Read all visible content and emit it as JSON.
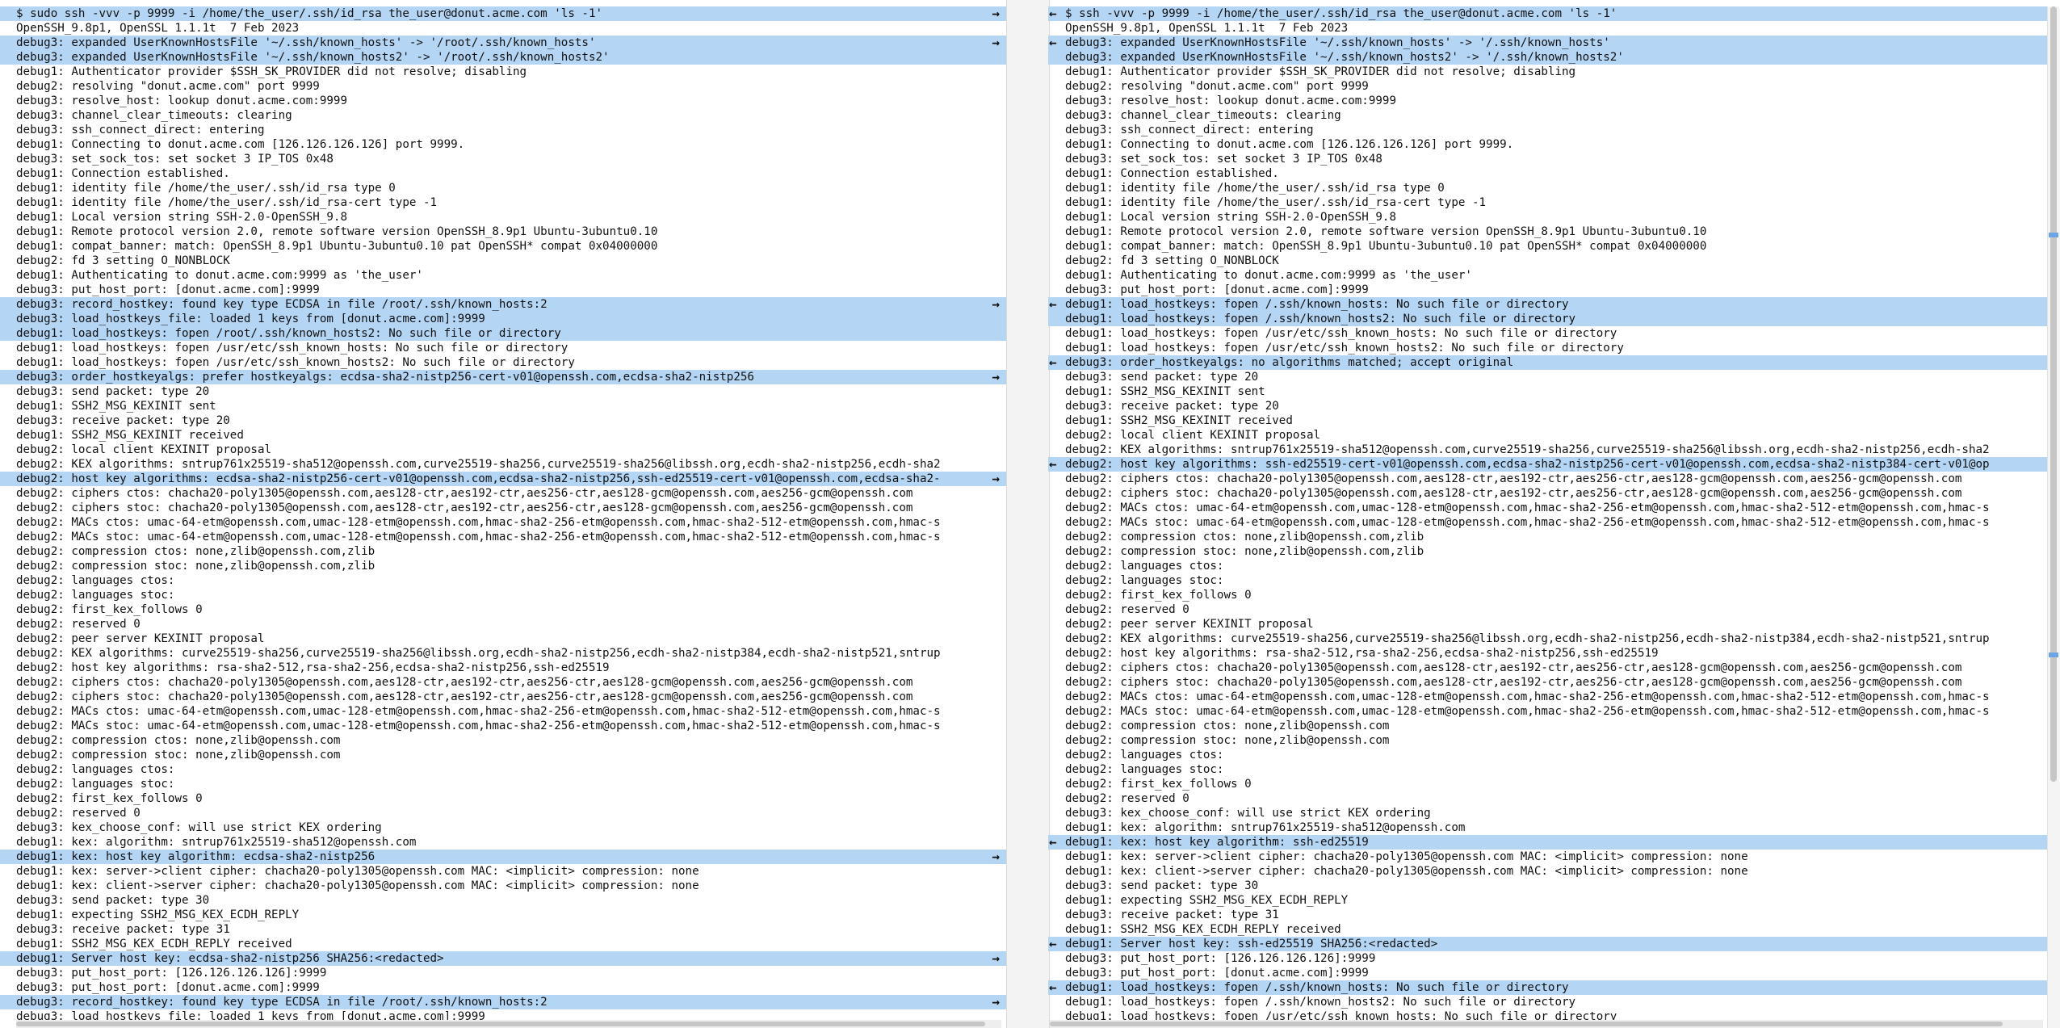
{
  "left": {
    "lines": [
      {
        "text": "$ sudo ssh -vvv -p 9999 -i /home/the_user/.ssh/id_rsa the_user@donut.acme.com 'ls -1'",
        "diff": true,
        "arrow": "→"
      },
      {
        "text": "OpenSSH_9.8p1, OpenSSL 1.1.1t  7 Feb 2023"
      },
      {
        "text": "debug3: expanded UserKnownHostsFile '~/.ssh/known_hosts' -> '/root/.ssh/known_hosts'",
        "diff": true,
        "arrow": "→"
      },
      {
        "text": "debug3: expanded UserKnownHostsFile '~/.ssh/known_hosts2' -> '/root/.ssh/known_hosts2'",
        "diff": true
      },
      {
        "text": "debug1: Authenticator provider $SSH_SK_PROVIDER did not resolve; disabling"
      },
      {
        "text": "debug2: resolving \"donut.acme.com\" port 9999"
      },
      {
        "text": "debug3: resolve_host: lookup donut.acme.com:9999"
      },
      {
        "text": "debug3: channel_clear_timeouts: clearing"
      },
      {
        "text": "debug3: ssh_connect_direct: entering"
      },
      {
        "text": "debug1: Connecting to donut.acme.com [126.126.126.126] port 9999."
      },
      {
        "text": "debug3: set_sock_tos: set socket 3 IP_TOS 0x48"
      },
      {
        "text": "debug1: Connection established."
      },
      {
        "text": "debug1: identity file /home/the_user/.ssh/id_rsa type 0"
      },
      {
        "text": "debug1: identity file /home/the_user/.ssh/id_rsa-cert type -1"
      },
      {
        "text": "debug1: Local version string SSH-2.0-OpenSSH_9.8"
      },
      {
        "text": "debug1: Remote protocol version 2.0, remote software version OpenSSH_8.9p1 Ubuntu-3ubuntu0.10"
      },
      {
        "text": "debug1: compat_banner: match: OpenSSH_8.9p1 Ubuntu-3ubuntu0.10 pat OpenSSH* compat 0x04000000"
      },
      {
        "text": "debug2: fd 3 setting O_NONBLOCK"
      },
      {
        "text": "debug1: Authenticating to donut.acme.com:9999 as 'the_user'"
      },
      {
        "text": "debug3: put_host_port: [donut.acme.com]:9999"
      },
      {
        "text": "debug3: record_hostkey: found key type ECDSA in file /root/.ssh/known_hosts:2",
        "diff": true,
        "arrow": "→"
      },
      {
        "text": "debug3: load_hostkeys_file: loaded 1 keys from [donut.acme.com]:9999",
        "diff": true
      },
      {
        "text": "debug1: load_hostkeys: fopen /root/.ssh/known_hosts2: No such file or directory",
        "diff": true
      },
      {
        "text": "debug1: load_hostkeys: fopen /usr/etc/ssh_known_hosts: No such file or directory"
      },
      {
        "text": "debug1: load_hostkeys: fopen /usr/etc/ssh_known_hosts2: No such file or directory"
      },
      {
        "text": "debug3: order_hostkeyalgs: prefer hostkeyalgs: ecdsa-sha2-nistp256-cert-v01@openssh.com,ecdsa-sha2-nistp256",
        "diff": true,
        "arrow": "→"
      },
      {
        "text": "debug3: send packet: type 20"
      },
      {
        "text": "debug1: SSH2_MSG_KEXINIT sent"
      },
      {
        "text": "debug3: receive packet: type 20"
      },
      {
        "text": "debug1: SSH2_MSG_KEXINIT received"
      },
      {
        "text": "debug2: local client KEXINIT proposal"
      },
      {
        "text": "debug2: KEX algorithms: sntrup761x25519-sha512@openssh.com,curve25519-sha256,curve25519-sha256@libssh.org,ecdh-sha2-nistp256,ecdh-sha2"
      },
      {
        "text": "debug2: host key algorithms: ecdsa-sha2-nistp256-cert-v01@openssh.com,ecdsa-sha2-nistp256,ssh-ed25519-cert-v01@openssh.com,ecdsa-sha2-",
        "diff": true,
        "arrow": "→"
      },
      {
        "text": "debug2: ciphers ctos: chacha20-poly1305@openssh.com,aes128-ctr,aes192-ctr,aes256-ctr,aes128-gcm@openssh.com,aes256-gcm@openssh.com"
      },
      {
        "text": "debug2: ciphers stoc: chacha20-poly1305@openssh.com,aes128-ctr,aes192-ctr,aes256-ctr,aes128-gcm@openssh.com,aes256-gcm@openssh.com"
      },
      {
        "text": "debug2: MACs ctos: umac-64-etm@openssh.com,umac-128-etm@openssh.com,hmac-sha2-256-etm@openssh.com,hmac-sha2-512-etm@openssh.com,hmac-s"
      },
      {
        "text": "debug2: MACs stoc: umac-64-etm@openssh.com,umac-128-etm@openssh.com,hmac-sha2-256-etm@openssh.com,hmac-sha2-512-etm@openssh.com,hmac-s"
      },
      {
        "text": "debug2: compression ctos: none,zlib@openssh.com,zlib"
      },
      {
        "text": "debug2: compression stoc: none,zlib@openssh.com,zlib"
      },
      {
        "text": "debug2: languages ctos:"
      },
      {
        "text": "debug2: languages stoc:"
      },
      {
        "text": "debug2: first_kex_follows 0"
      },
      {
        "text": "debug2: reserved 0"
      },
      {
        "text": "debug2: peer server KEXINIT proposal"
      },
      {
        "text": "debug2: KEX algorithms: curve25519-sha256,curve25519-sha256@libssh.org,ecdh-sha2-nistp256,ecdh-sha2-nistp384,ecdh-sha2-nistp521,sntrup"
      },
      {
        "text": "debug2: host key algorithms: rsa-sha2-512,rsa-sha2-256,ecdsa-sha2-nistp256,ssh-ed25519"
      },
      {
        "text": "debug2: ciphers ctos: chacha20-poly1305@openssh.com,aes128-ctr,aes192-ctr,aes256-ctr,aes128-gcm@openssh.com,aes256-gcm@openssh.com"
      },
      {
        "text": "debug2: ciphers stoc: chacha20-poly1305@openssh.com,aes128-ctr,aes192-ctr,aes256-ctr,aes128-gcm@openssh.com,aes256-gcm@openssh.com"
      },
      {
        "text": "debug2: MACs ctos: umac-64-etm@openssh.com,umac-128-etm@openssh.com,hmac-sha2-256-etm@openssh.com,hmac-sha2-512-etm@openssh.com,hmac-s"
      },
      {
        "text": "debug2: MACs stoc: umac-64-etm@openssh.com,umac-128-etm@openssh.com,hmac-sha2-256-etm@openssh.com,hmac-sha2-512-etm@openssh.com,hmac-s"
      },
      {
        "text": "debug2: compression ctos: none,zlib@openssh.com"
      },
      {
        "text": "debug2: compression stoc: none,zlib@openssh.com"
      },
      {
        "text": "debug2: languages ctos:"
      },
      {
        "text": "debug2: languages stoc:"
      },
      {
        "text": "debug2: first_kex_follows 0"
      },
      {
        "text": "debug2: reserved 0"
      },
      {
        "text": "debug3: kex_choose_conf: will use strict KEX ordering"
      },
      {
        "text": "debug1: kex: algorithm: sntrup761x25519-sha512@openssh.com"
      },
      {
        "text": "debug1: kex: host key algorithm: ecdsa-sha2-nistp256",
        "diff": true,
        "arrow": "→"
      },
      {
        "text": "debug1: kex: server->client cipher: chacha20-poly1305@openssh.com MAC: <implicit> compression: none"
      },
      {
        "text": "debug1: kex: client->server cipher: chacha20-poly1305@openssh.com MAC: <implicit> compression: none"
      },
      {
        "text": "debug3: send packet: type 30"
      },
      {
        "text": "debug1: expecting SSH2_MSG_KEX_ECDH_REPLY"
      },
      {
        "text": "debug3: receive packet: type 31"
      },
      {
        "text": "debug1: SSH2_MSG_KEX_ECDH_REPLY received"
      },
      {
        "text": "debug1: Server host key: ecdsa-sha2-nistp256 SHA256:<redacted>",
        "diff": true,
        "arrow": "→"
      },
      {
        "text": "debug3: put_host_port: [126.126.126.126]:9999"
      },
      {
        "text": "debug3: put_host_port: [donut.acme.com]:9999"
      },
      {
        "text": "debug3: record_hostkey: found key type ECDSA in file /root/.ssh/known_hosts:2",
        "diff": true,
        "arrow": "→"
      },
      {
        "text": "debug3: load_hostkeys_file: loaded 1 keys from [donut.acme.com]:9999"
      }
    ]
  },
  "right": {
    "lines": [
      {
        "text": "$ ssh -vvv -p 9999 -i /home/the_user/.ssh/id_rsa the_user@donut.acme.com 'ls -1'",
        "diff": true,
        "arrow": "←"
      },
      {
        "text": "OpenSSH_9.8p1, OpenSSL 1.1.1t  7 Feb 2023"
      },
      {
        "text": "debug3: expanded UserKnownHostsFile '~/.ssh/known_hosts' -> '/.ssh/known_hosts'",
        "diff": true,
        "arrow": "←"
      },
      {
        "text": "debug3: expanded UserKnownHostsFile '~/.ssh/known_hosts2' -> '/.ssh/known_hosts2'",
        "diff": true
      },
      {
        "text": "debug1: Authenticator provider $SSH_SK_PROVIDER did not resolve; disabling"
      },
      {
        "text": "debug2: resolving \"donut.acme.com\" port 9999"
      },
      {
        "text": "debug3: resolve_host: lookup donut.acme.com:9999"
      },
      {
        "text": "debug3: channel_clear_timeouts: clearing"
      },
      {
        "text": "debug3: ssh_connect_direct: entering"
      },
      {
        "text": "debug1: Connecting to donut.acme.com [126.126.126.126] port 9999."
      },
      {
        "text": "debug3: set_sock_tos: set socket 3 IP_TOS 0x48"
      },
      {
        "text": "debug1: Connection established."
      },
      {
        "text": "debug1: identity file /home/the_user/.ssh/id_rsa type 0"
      },
      {
        "text": "debug1: identity file /home/the_user/.ssh/id_rsa-cert type -1"
      },
      {
        "text": "debug1: Local version string SSH-2.0-OpenSSH_9.8"
      },
      {
        "text": "debug1: Remote protocol version 2.0, remote software version OpenSSH_8.9p1 Ubuntu-3ubuntu0.10"
      },
      {
        "text": "debug1: compat_banner: match: OpenSSH_8.9p1 Ubuntu-3ubuntu0.10 pat OpenSSH* compat 0x04000000"
      },
      {
        "text": "debug2: fd 3 setting O_NONBLOCK"
      },
      {
        "text": "debug1: Authenticating to donut.acme.com:9999 as 'the_user'"
      },
      {
        "text": "debug3: put_host_port: [donut.acme.com]:9999"
      },
      {
        "text": "debug1: load_hostkeys: fopen /.ssh/known_hosts: No such file or directory",
        "diff": true,
        "arrow": "←"
      },
      {
        "text": "debug1: load_hostkeys: fopen /.ssh/known_hosts2: No such file or directory",
        "diff": true
      },
      {
        "text": "debug1: load_hostkeys: fopen /usr/etc/ssh_known_hosts: No such file or directory"
      },
      {
        "text": "debug1: load_hostkeys: fopen /usr/etc/ssh_known_hosts2: No such file or directory"
      },
      {
        "text": "debug3: order_hostkeyalgs: no algorithms matched; accept original",
        "diff": true,
        "arrow": "←"
      },
      {
        "text": "debug3: send packet: type 20"
      },
      {
        "text": "debug1: SSH2_MSG_KEXINIT sent"
      },
      {
        "text": "debug3: receive packet: type 20"
      },
      {
        "text": "debug1: SSH2_MSG_KEXINIT received"
      },
      {
        "text": "debug2: local client KEXINIT proposal"
      },
      {
        "text": "debug2: KEX algorithms: sntrup761x25519-sha512@openssh.com,curve25519-sha256,curve25519-sha256@libssh.org,ecdh-sha2-nistp256,ecdh-sha2"
      },
      {
        "text": "debug2: host key algorithms: ssh-ed25519-cert-v01@openssh.com,ecdsa-sha2-nistp256-cert-v01@openssh.com,ecdsa-sha2-nistp384-cert-v01@op",
        "diff": true,
        "arrow": "←"
      },
      {
        "text": "debug2: ciphers ctos: chacha20-poly1305@openssh.com,aes128-ctr,aes192-ctr,aes256-ctr,aes128-gcm@openssh.com,aes256-gcm@openssh.com"
      },
      {
        "text": "debug2: ciphers stoc: chacha20-poly1305@openssh.com,aes128-ctr,aes192-ctr,aes256-ctr,aes128-gcm@openssh.com,aes256-gcm@openssh.com"
      },
      {
        "text": "debug2: MACs ctos: umac-64-etm@openssh.com,umac-128-etm@openssh.com,hmac-sha2-256-etm@openssh.com,hmac-sha2-512-etm@openssh.com,hmac-s"
      },
      {
        "text": "debug2: MACs stoc: umac-64-etm@openssh.com,umac-128-etm@openssh.com,hmac-sha2-256-etm@openssh.com,hmac-sha2-512-etm@openssh.com,hmac-s"
      },
      {
        "text": "debug2: compression ctos: none,zlib@openssh.com,zlib"
      },
      {
        "text": "debug2: compression stoc: none,zlib@openssh.com,zlib"
      },
      {
        "text": "debug2: languages ctos:"
      },
      {
        "text": "debug2: languages stoc:"
      },
      {
        "text": "debug2: first_kex_follows 0"
      },
      {
        "text": "debug2: reserved 0"
      },
      {
        "text": "debug2: peer server KEXINIT proposal"
      },
      {
        "text": "debug2: KEX algorithms: curve25519-sha256,curve25519-sha256@libssh.org,ecdh-sha2-nistp256,ecdh-sha2-nistp384,ecdh-sha2-nistp521,sntrup"
      },
      {
        "text": "debug2: host key algorithms: rsa-sha2-512,rsa-sha2-256,ecdsa-sha2-nistp256,ssh-ed25519"
      },
      {
        "text": "debug2: ciphers ctos: chacha20-poly1305@openssh.com,aes128-ctr,aes192-ctr,aes256-ctr,aes128-gcm@openssh.com,aes256-gcm@openssh.com"
      },
      {
        "text": "debug2: ciphers stoc: chacha20-poly1305@openssh.com,aes128-ctr,aes192-ctr,aes256-ctr,aes128-gcm@openssh.com,aes256-gcm@openssh.com"
      },
      {
        "text": "debug2: MACs ctos: umac-64-etm@openssh.com,umac-128-etm@openssh.com,hmac-sha2-256-etm@openssh.com,hmac-sha2-512-etm@openssh.com,hmac-s"
      },
      {
        "text": "debug2: MACs stoc: umac-64-etm@openssh.com,umac-128-etm@openssh.com,hmac-sha2-256-etm@openssh.com,hmac-sha2-512-etm@openssh.com,hmac-s"
      },
      {
        "text": "debug2: compression ctos: none,zlib@openssh.com"
      },
      {
        "text": "debug2: compression stoc: none,zlib@openssh.com"
      },
      {
        "text": "debug2: languages ctos:"
      },
      {
        "text": "debug2: languages stoc:"
      },
      {
        "text": "debug2: first_kex_follows 0"
      },
      {
        "text": "debug2: reserved 0"
      },
      {
        "text": "debug3: kex_choose_conf: will use strict KEX ordering"
      },
      {
        "text": "debug1: kex: algorithm: sntrup761x25519-sha512@openssh.com"
      },
      {
        "text": "debug1: kex: host key algorithm: ssh-ed25519",
        "diff": true,
        "arrow": "←"
      },
      {
        "text": "debug1: kex: server->client cipher: chacha20-poly1305@openssh.com MAC: <implicit> compression: none"
      },
      {
        "text": "debug1: kex: client->server cipher: chacha20-poly1305@openssh.com MAC: <implicit> compression: none"
      },
      {
        "text": "debug3: send packet: type 30"
      },
      {
        "text": "debug1: expecting SSH2_MSG_KEX_ECDH_REPLY"
      },
      {
        "text": "debug3: receive packet: type 31"
      },
      {
        "text": "debug1: SSH2_MSG_KEX_ECDH_REPLY received"
      },
      {
        "text": "debug1: Server host key: ssh-ed25519 SHA256:<redacted>",
        "diff": true,
        "arrow": "←"
      },
      {
        "text": "debug3: put_host_port: [126.126.126.126]:9999"
      },
      {
        "text": "debug3: put_host_port: [donut.acme.com]:9999"
      },
      {
        "text": "debug1: load_hostkeys: fopen /.ssh/known_hosts: No such file or directory",
        "diff": true,
        "arrow": "←"
      },
      {
        "text": "debug1: load_hostkeys: fopen /.ssh/known_hosts2: No such file or directory"
      },
      {
        "text": "debug1: load_hostkeys: fopen /usr/etc/ssh_known_hosts: No such file or directory"
      }
    ]
  },
  "colors": {
    "diff_line": "#b5d5f5",
    "diff_highlight": "#84baee"
  }
}
